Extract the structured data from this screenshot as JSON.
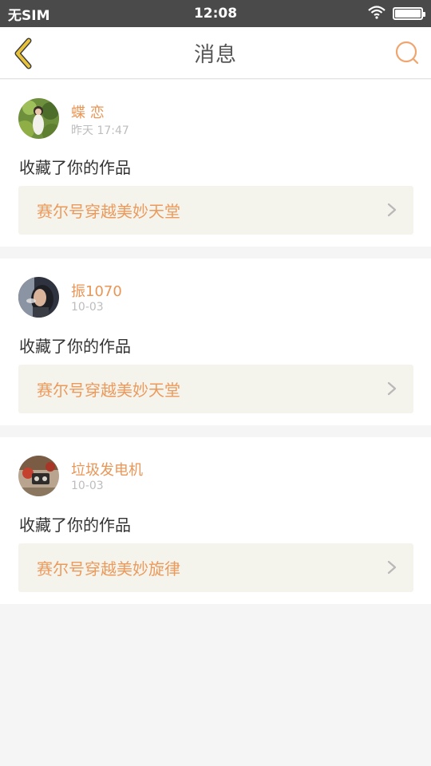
{
  "status_bar": {
    "carrier": "无SIM",
    "time": "12:08",
    "battery_level": 1.0
  },
  "header": {
    "title": "消息",
    "back_icon": "chevron-left-icon",
    "search_icon": "search-icon"
  },
  "colors": {
    "accent": "#e99657",
    "link_text": "#ec9a5c",
    "link_bg": "#f4f4ec",
    "back_arrow": "#e8c23a"
  },
  "messages": [
    {
      "user": "蝶 恋",
      "time": "昨天 17:47",
      "text": "收藏了你的作品",
      "work": "赛尔号穿越美妙天堂"
    },
    {
      "user": "振1070",
      "time": "10-03",
      "text": "收藏了你的作品",
      "work": "赛尔号穿越美妙天堂"
    },
    {
      "user": "垃圾发电机",
      "time": "10-03",
      "text": "收藏了你的作品",
      "work": "赛尔号穿越美妙旋律"
    }
  ]
}
